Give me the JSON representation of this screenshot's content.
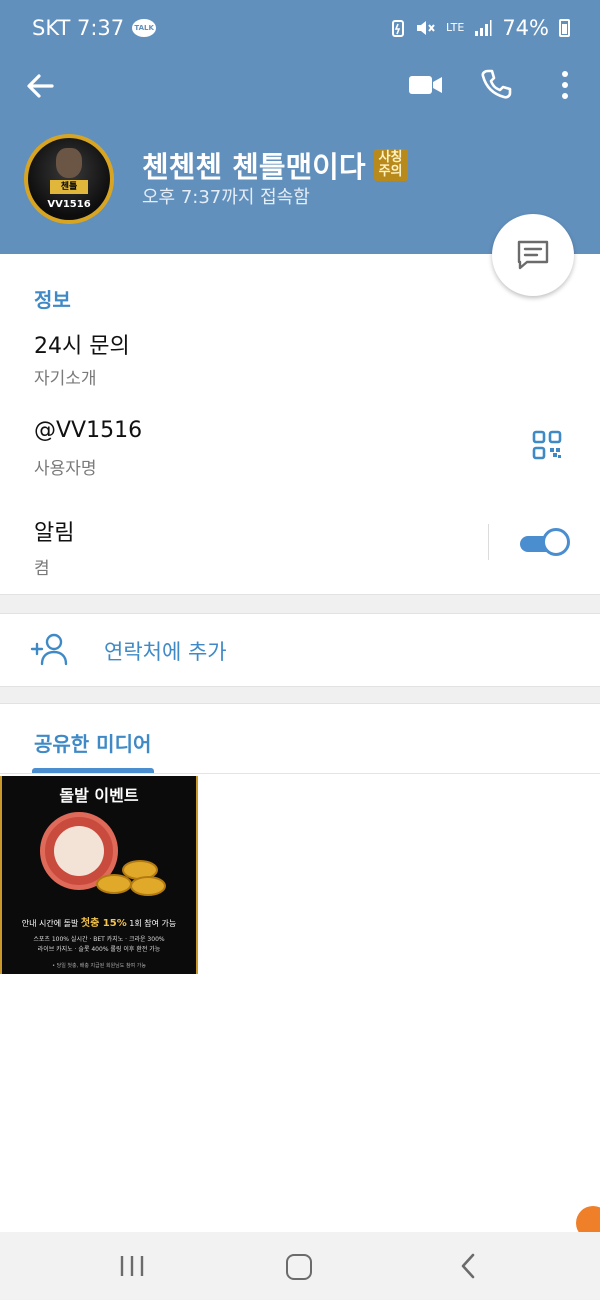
{
  "status_bar": {
    "carrier_time": "SKT 7:37",
    "talk_badge": "TALK",
    "network": "LTE",
    "battery": "74%"
  },
  "toolbar": {
    "back_icon": "arrow-left-icon",
    "video_icon": "video-camera-icon",
    "call_icon": "phone-icon",
    "more_icon": "vertical-dots-icon"
  },
  "profile": {
    "avatar_badge": "VV1516",
    "name": "첸첸첸 첸틀맨이다",
    "name_badge": "사칭주의",
    "last_seen": "오후 7:37까지 접속함"
  },
  "info": {
    "section_title": "정보",
    "bio_value": "24시 문의",
    "bio_label": "자기소개",
    "username_value": "@VV1516",
    "username_label": "사용자명",
    "notify_value": "알림",
    "notify_state": "켬",
    "notify_on": true
  },
  "add_contact": {
    "label": "연락처에 추가"
  },
  "media": {
    "section_title": "공유한 미디어",
    "thumb": {
      "title": "돌발 이벤트",
      "line1_pre": "안내 시간에 돌발",
      "line1_highlight": "첫충 15%",
      "line1_post": "1회 참여 가능",
      "line2": "스포츠 100% 실시간 · BET 카지노 · 크라운 300%",
      "line3": "라이브 카지노 · 슬롯 400% 롤링 이후 환전 가능",
      "line4": "• 당일 첫충, 배충 지급된 회원님도 참여 가능"
    }
  },
  "colors": {
    "header": "#6290bd",
    "accent": "#3f8ac6",
    "toggle": "#4a8ed0"
  }
}
